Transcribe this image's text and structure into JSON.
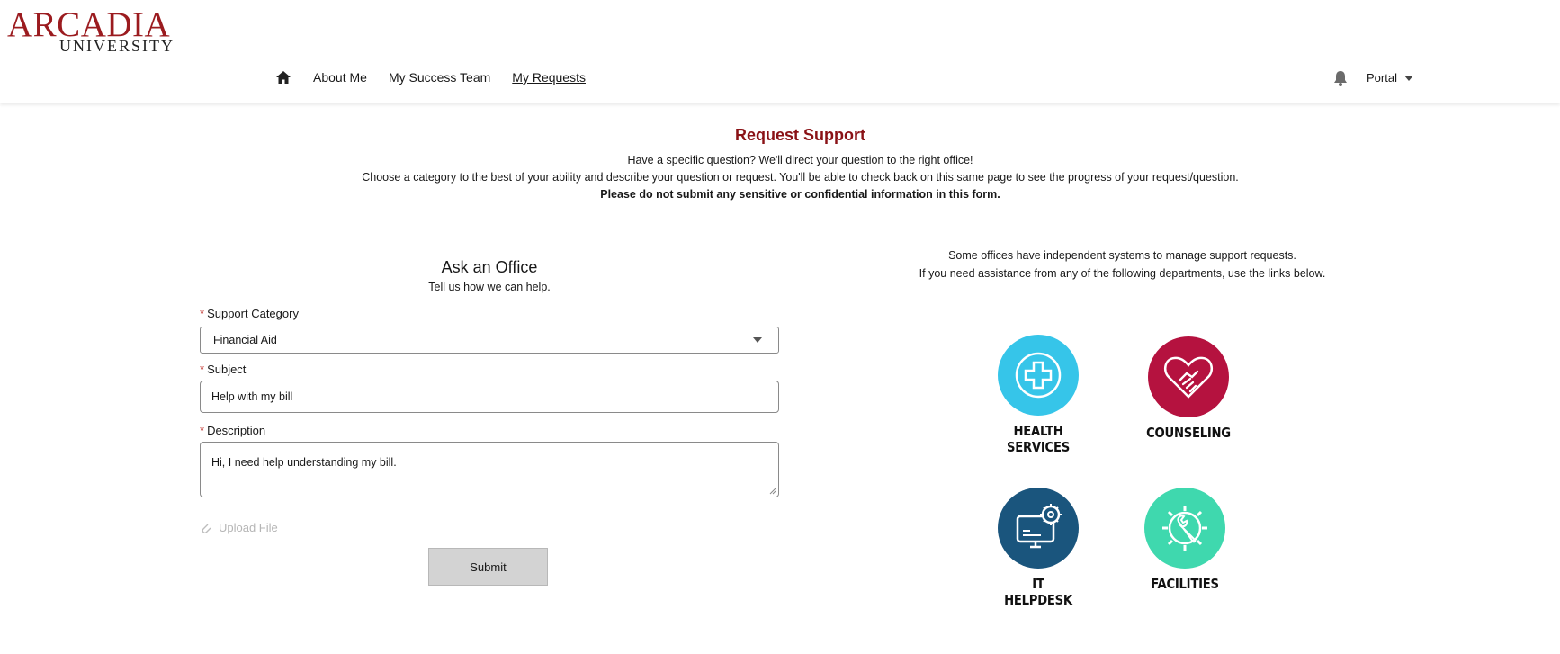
{
  "brand": {
    "line1": "ARCADIA",
    "line2": "UNIVERSITY",
    "color": "#9b1b1f"
  },
  "nav": {
    "home_icon": "home-icon",
    "items": [
      "About Me",
      "My Success Team",
      "My Requests"
    ],
    "active": "My Requests"
  },
  "header_right": {
    "bell_icon": "bell-icon",
    "portal_label": "Portal"
  },
  "hero": {
    "title": "Request Support",
    "line1": "Have a specific question? We'll direct your question to the right office!",
    "line2": "Choose a category to the best of your ability and describe your question or request. You'll be able to check back on this same page to see the progress of your request/question.",
    "line3": "Please do not submit any sensitive or confidential information in this form."
  },
  "form": {
    "title": "Ask an Office",
    "subtitle": "Tell us how we can help.",
    "category_label": "Support Category",
    "category_value": "Financial Aid",
    "subject_label": "Subject",
    "subject_value": "Help with my bill",
    "description_label": "Description",
    "description_value": "Hi, I need help understanding my bill.",
    "upload_label": "Upload File",
    "submit_label": "Submit",
    "required_mark": "*"
  },
  "offices": {
    "line1": "Some offices have independent systems to manage support requests.",
    "line2": "If you need assistance from any of the following departments, use the links below.",
    "tiles": [
      {
        "name": "HEALTH\nSERVICES",
        "color": "#36c5e9",
        "icon": "medical-cross-icon"
      },
      {
        "name": "COUNSELING",
        "color": "#b5123f",
        "icon": "heart-handshake-icon"
      },
      {
        "name": "IT\nHELPDESK",
        "color": "#1a557d",
        "icon": "computer-gear-icon"
      },
      {
        "name": "FACILITIES",
        "color": "#3fd8ae",
        "icon": "gear-wrench-icon"
      }
    ]
  }
}
